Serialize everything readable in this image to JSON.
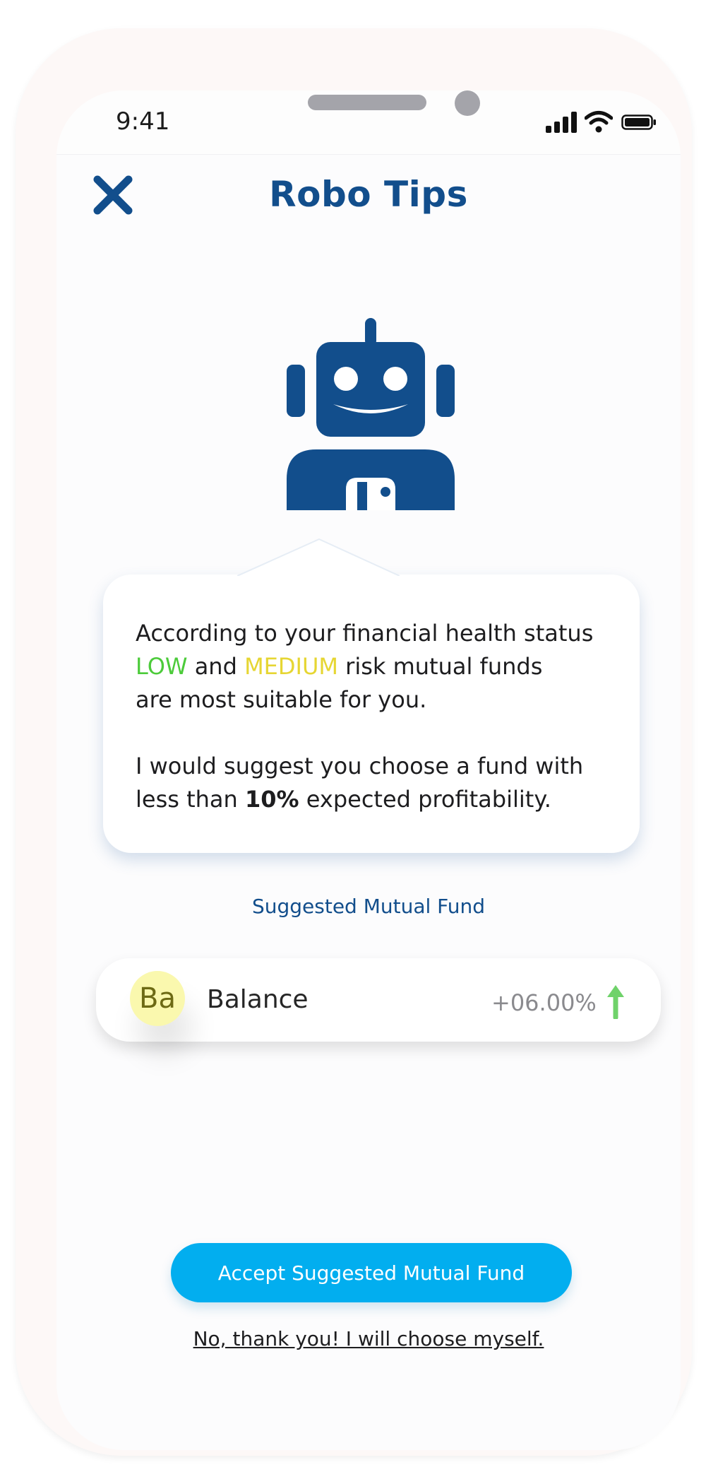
{
  "status_bar": {
    "time": "9:41"
  },
  "header": {
    "title": "Robo Tips",
    "close_icon": "close-icon"
  },
  "illustration": {
    "icon": "robot-icon"
  },
  "tip": {
    "line1": "According to your financial health status",
    "risk_low": "LOW",
    "and": "and",
    "risk_medium": "MEDIUM",
    "line2_tail": "risk mutual funds",
    "line3": "are most suitable for you.",
    "suggest_prefix": "I would suggest you choose a fund with",
    "less_than": "less than",
    "threshold": "10%",
    "suggest_suffix": "expected profitability."
  },
  "suggestion": {
    "label": "Suggested Mutual Fund",
    "fund": {
      "abbr": "Ba",
      "name": "Balance",
      "return": "+06.00%",
      "trend_icon": "arrow-up-icon"
    }
  },
  "actions": {
    "accept_label": "Accept Suggested Mutual Fund",
    "decline_label": "No, thank you! I will choose myself."
  },
  "colors": {
    "primary": "#124e8c",
    "accent": "#02aeef",
    "low": "#4ccb3a",
    "medium": "#e6d633",
    "trend_up": "#6fd26a"
  }
}
